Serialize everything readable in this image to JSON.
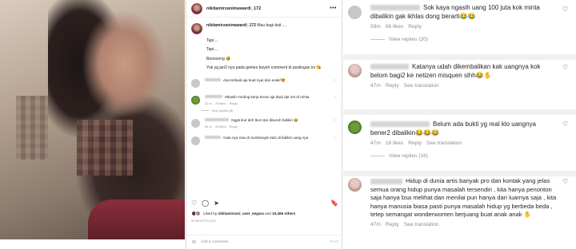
{
  "post": {
    "username": "nikitamirzanimawardi_172",
    "caption_text": "Mau bagi duit ....",
    "caption_lines": [
      "Tapi....",
      "Tapi....",
      "Booooong 🤣",
      "Yuk yg jari2 nya pada gemes boyeh comment di postingan ini 😘"
    ],
    "comments": [
      {
        "text": "doa terbaik aja buat nyai dan anak²😍",
        "meta": [],
        "replies": ""
      },
      {
        "text": "Mkasih mnding kerja keras aja drpd dpt nrti di minta",
        "meta": [
          "41 m",
          "76 likes",
          "Reply"
        ],
        "replies": "View replies (6)"
      },
      {
        "text": "Nggk ikut deh tkut ntar disuruh balikin 😂",
        "meta": [
          "54 m",
          "15 likes",
          "Reply"
        ],
        "replies": ""
      },
      {
        "text": "Kata nya mau di sumbangin kalo di balikin uang nya",
        "meta": [],
        "replies": ""
      }
    ],
    "liked_by_user": "nikitamirzani_aset_negara",
    "liked_by_count": "15,496 others",
    "liked_prefix": "Liked by",
    "liked_and": "and",
    "date": "50 MINUTES AGO",
    "add_comment_placeholder": "Add a comment...",
    "post_label": "Post"
  },
  "thread": [
    {
      "text": "Sok kaya ngasih uang 100 juta kok minta dibalikin gak ikhlas dong berarti😂😂",
      "meta": [
        "59m",
        "66 likes",
        "Reply"
      ],
      "replies": "View replies (20)"
    },
    {
      "text": "Katanya udah dikembalikan kak uangnya kok belom bagi2 ke netizen misquen sihh😂✋",
      "meta": [
        "47m",
        "Reply",
        "See translation"
      ],
      "replies": ""
    },
    {
      "text": "Belum ada bukti yg real klo uangnya bener2 dibalikin😂😂😂",
      "meta": [
        "47m",
        "16 likes",
        "Reply",
        "See translation"
      ],
      "replies": "View replies (16)"
    },
    {
      "text": "Hidup di dunia artis banyak pro dan kontak yang jelas semua orang hidup punya masalah tersendiri , kita hanya penonton saja hanya bsa melihat dan menilai pun hanya dari luarnya saja , kita hanya manusia biasa pasti punya masalah hidup yg berbeda beda , tetep semangat wonderwomen berjuang buat anak anak ✋",
      "meta": [
        "47m",
        "Reply",
        "See translation"
      ],
      "replies": ""
    }
  ],
  "icons": {
    "heart": "♡",
    "comment": "◯",
    "share": "➤",
    "bookmark": "🔖",
    "more": "•••",
    "emoji": "☺"
  }
}
